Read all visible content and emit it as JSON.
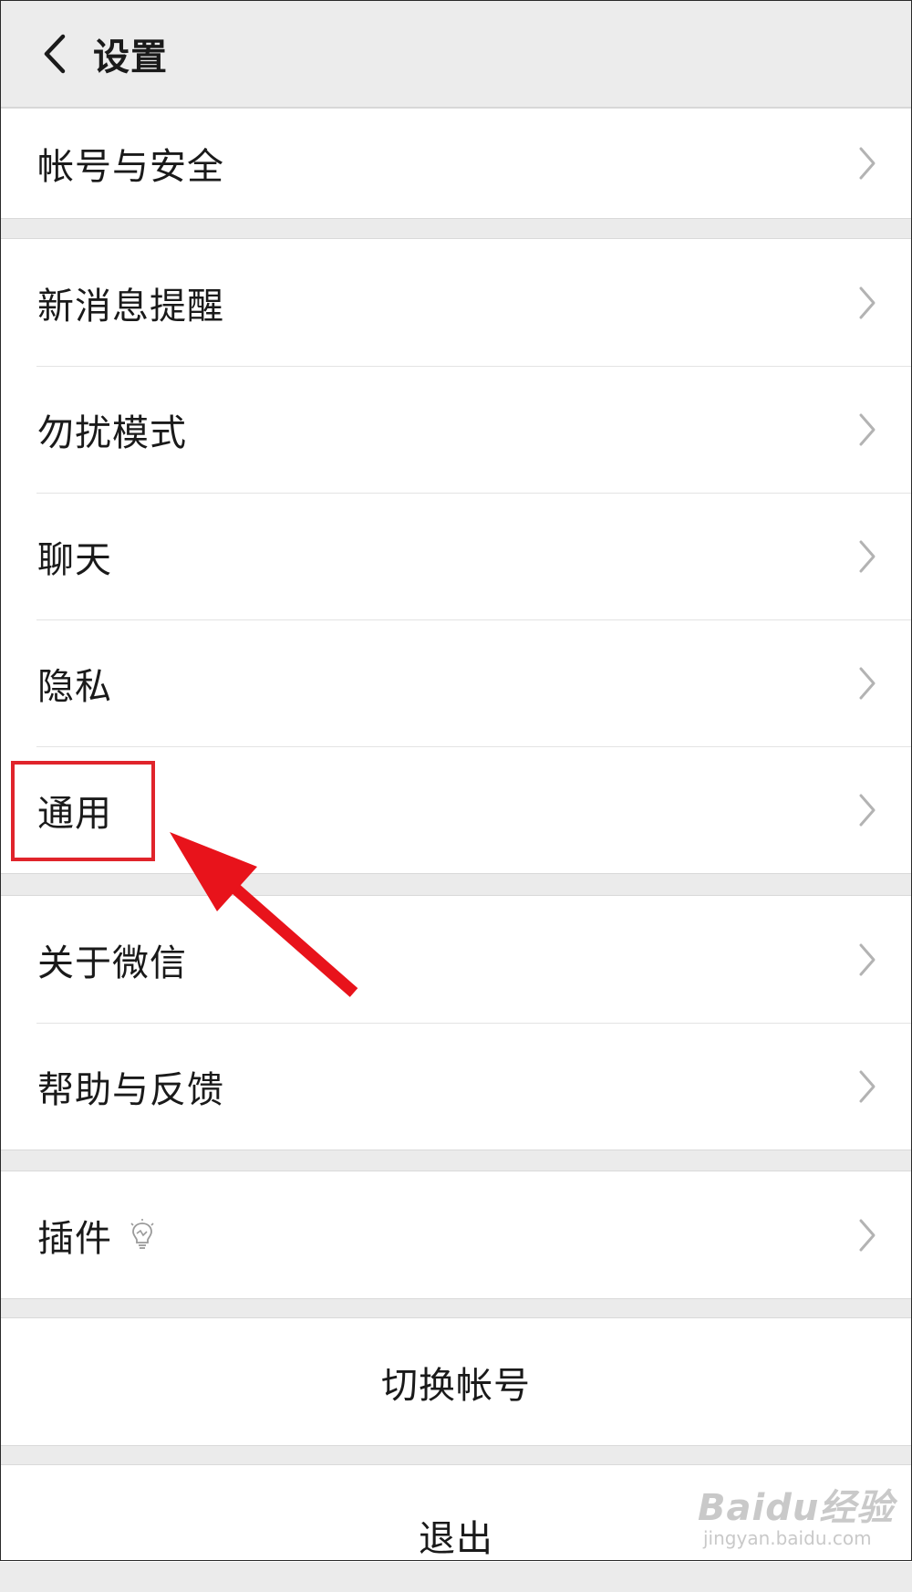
{
  "header": {
    "title": "设置",
    "back_icon": "chevron-left-icon"
  },
  "groups": {
    "account": {
      "items": [
        {
          "label": "帐号与安全"
        }
      ]
    },
    "main": {
      "items": [
        {
          "label": "新消息提醒"
        },
        {
          "label": "勿扰模式"
        },
        {
          "label": "聊天"
        },
        {
          "label": "隐私"
        },
        {
          "label": "通用"
        }
      ]
    },
    "about": {
      "items": [
        {
          "label": "关于微信"
        },
        {
          "label": "帮助与反馈"
        }
      ]
    },
    "plugins": {
      "items": [
        {
          "label": "插件",
          "icon": "lightbulb-icon"
        }
      ]
    }
  },
  "actions": {
    "switch_account": "切换帐号",
    "logout": "退出"
  },
  "annotation": {
    "highlighted_item": "通用",
    "color": "#e0242b"
  },
  "watermark": {
    "text": "Baidu经验",
    "sub": "jingyan.baidu.com"
  }
}
